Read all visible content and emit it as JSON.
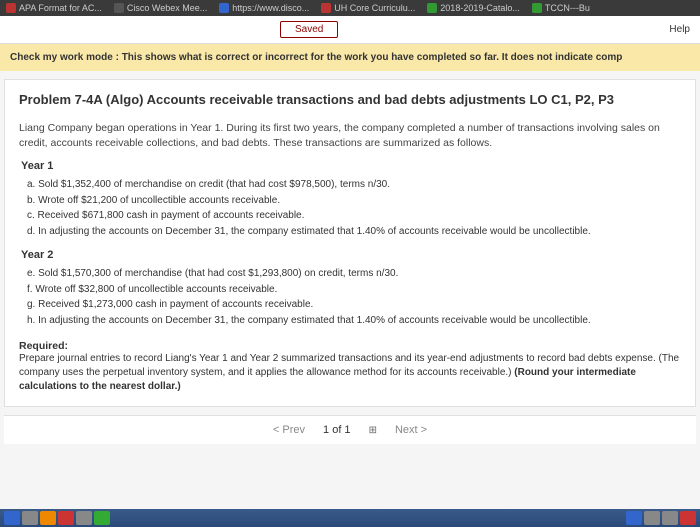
{
  "tabs": {
    "t0": "APA Format for AC...",
    "t1": "Cisco Webex Mee...",
    "t2": "https://www.disco...",
    "t3": "UH Core Curriculu...",
    "t4": "2018-2019-Catalo...",
    "t5": "TCCN---Bu"
  },
  "toolbar": {
    "saved": "Saved",
    "help": "Help"
  },
  "checkwork": "Check my work mode : This shows what is correct or incorrect for the work you have completed so far. It does not indicate comp",
  "problem": {
    "title": "Problem 7-4A (Algo) Accounts receivable transactions and bad debts adjustments LO C1, P2, P3",
    "desc": "Liang Company began operations in Year 1. During its first two years, the company completed a number of transactions involving sales on credit, accounts receivable collections, and bad debts. These transactions are summarized as follows.",
    "year1_label": "Year 1",
    "year1": {
      "a": "a. Sold $1,352,400 of merchandise on credit (that had cost $978,500), terms n/30.",
      "b": "b. Wrote off $21,200 of uncollectible accounts receivable.",
      "c": "c. Received $671,800 cash in payment of accounts receivable.",
      "d": "d. In adjusting the accounts on December 31, the company estimated that 1.40% of accounts receivable would be uncollectible."
    },
    "year2_label": "Year 2",
    "year2": {
      "e": "e. Sold $1,570,300 of merchandise (that had cost $1,293,800) on credit, terms n/30.",
      "f": "f. Wrote off $32,800 of uncollectible accounts receivable.",
      "g": "g. Received $1,273,000 cash in payment of accounts receivable.",
      "h": "h. In adjusting the accounts on December 31, the company estimated that 1.40% of accounts receivable would be uncollectible."
    },
    "required_label": "Required:",
    "required_text": "Prepare journal entries to record Liang's Year 1 and Year 2 summarized transactions and its year-end adjustments to record bad debts expense. (The company uses the perpetual inventory system, and it applies the allowance method for its accounts receivable.) ",
    "required_note": "(Round your intermediate calculations to the nearest dollar.)"
  },
  "nav": {
    "prev": "Prev",
    "count": "1 of 1",
    "next": "Next"
  }
}
